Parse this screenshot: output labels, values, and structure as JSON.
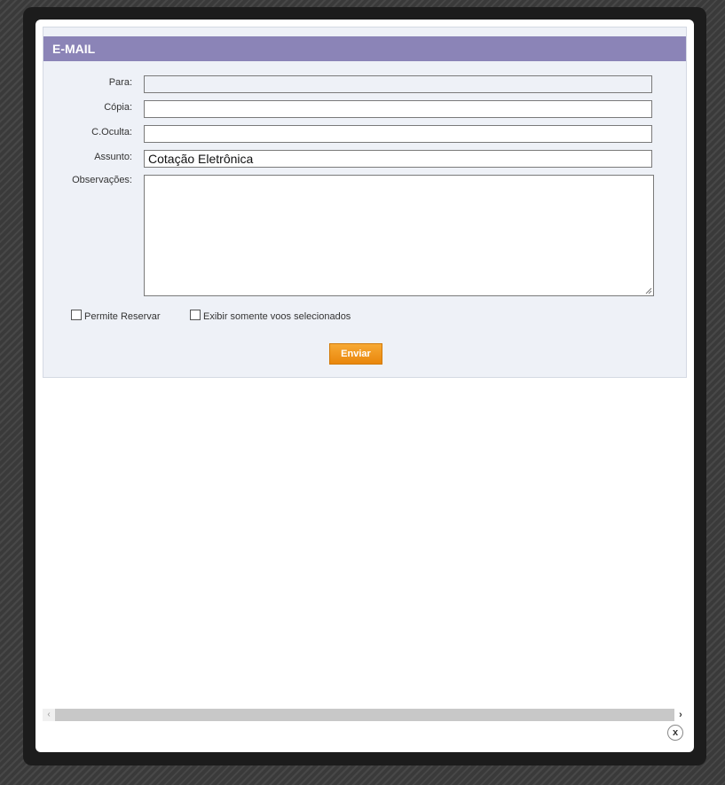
{
  "email": {
    "title": "E-MAIL",
    "fields": {
      "para": {
        "label": "Para:",
        "value": ""
      },
      "copia": {
        "label": "Cópia:",
        "value": ""
      },
      "coculta": {
        "label": "C.Oculta:",
        "value": ""
      },
      "assunto": {
        "label": "Assunto:",
        "value": "Cotação Eletrônica"
      },
      "observacoes": {
        "label": "Observações:",
        "value": ""
      }
    },
    "options": {
      "permite_reservar": {
        "label": "Permite Reservar",
        "checked": false
      },
      "exibir_voos": {
        "label": "Exibir somente voos selecionados",
        "checked": false
      }
    },
    "send_label": "Enviar"
  },
  "scrollbar": {
    "left_icon": "‹",
    "right_icon": "›"
  },
  "close_icon": "x",
  "colors": {
    "header": "#8b84b7",
    "button": "#f39a1e",
    "panel": "#eef1f7"
  }
}
